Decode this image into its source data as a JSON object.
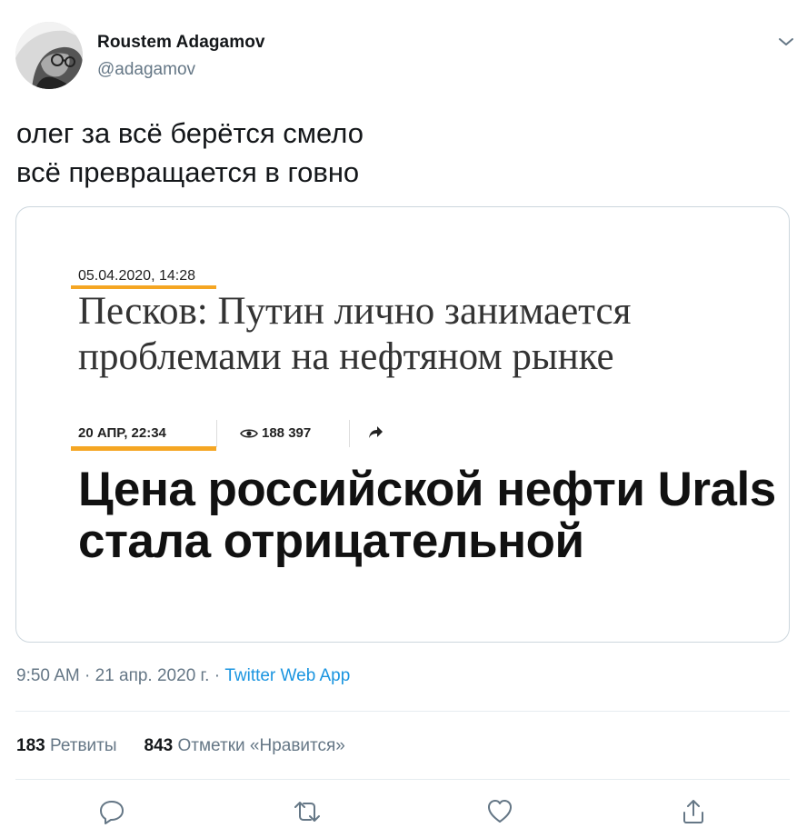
{
  "user": {
    "name": "Roustem Adagamov",
    "handle": "@adagamov"
  },
  "tweet": {
    "text": "олег за всё берётся смело\nвсё превращается в говно"
  },
  "card": {
    "news1": {
      "date": "05.04.2020, 14:28",
      "title": "Песков: Путин лично занимается проблемами на нефтяном рынке"
    },
    "news2": {
      "date": "20 АПР, 22:34",
      "views": "188 397",
      "title": "Цена российской нефти Urals стала отрицательной"
    },
    "accent_color": "#f5a623"
  },
  "footer": {
    "time": "9:50 AM · 21 апр. 2020 г. · ",
    "source": "Twitter Web App"
  },
  "stats": {
    "retweets_count": "183",
    "retweets_label": "Ретвиты",
    "likes_count": "843",
    "likes_label": "Отметки «Нравится»"
  },
  "icons": [
    "chevron-down-icon",
    "eye-icon",
    "share-arrow-icon",
    "reply-icon",
    "retweet-icon",
    "like-icon",
    "share-icon"
  ]
}
